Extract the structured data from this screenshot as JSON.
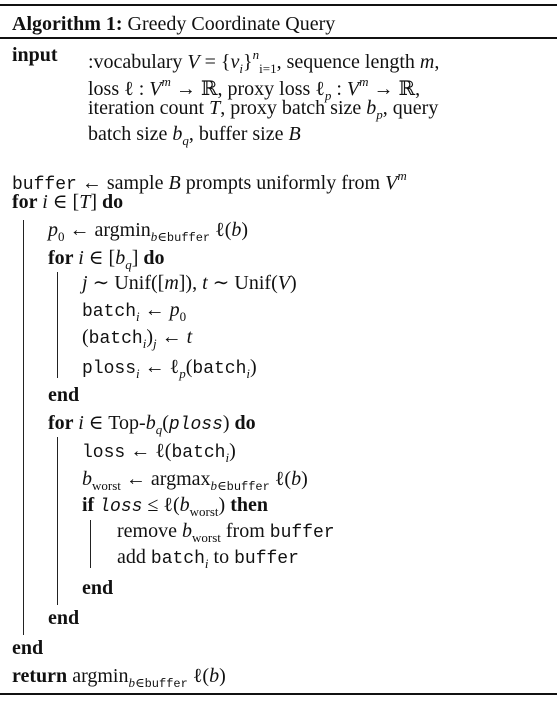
{
  "title": {
    "label": "Algorithm 1:",
    "name": "Greedy Coordinate Query"
  },
  "lines": [
    [
      [
        "b",
        "input"
      ]
    ],
    [
      [
        "r",
        ":vocabulary "
      ],
      [
        "i",
        "V"
      ],
      [
        "r",
        " = {"
      ],
      [
        "i",
        "v"
      ],
      [
        "i sub",
        "i"
      ],
      [
        "r",
        "}"
      ],
      [
        "i sup",
        "n"
      ],
      [
        "r sub",
        "i=1"
      ],
      [
        "r",
        ", sequence length "
      ],
      [
        "i",
        "m"
      ],
      [
        "r",
        ","
      ]
    ],
    [
      [
        "r",
        "loss ℓ : "
      ],
      [
        "i",
        "V"
      ],
      [
        "i sup",
        "m"
      ],
      [
        "r",
        " → ℝ, proxy loss ℓ"
      ],
      [
        "i sub",
        "p"
      ],
      [
        "r",
        " : "
      ],
      [
        "i",
        "V"
      ],
      [
        "i sup",
        "m"
      ],
      [
        "r",
        " → ℝ,"
      ]
    ],
    [
      [
        "r",
        "iteration count "
      ],
      [
        "i",
        "T"
      ],
      [
        "r",
        ", proxy batch size "
      ],
      [
        "i",
        "b"
      ],
      [
        "i sub",
        "p"
      ],
      [
        "r",
        ", query"
      ]
    ],
    [
      [
        "r",
        "batch size "
      ],
      [
        "i",
        "b"
      ],
      [
        "i sub",
        "q"
      ],
      [
        "r",
        ", buffer size "
      ],
      [
        "i",
        "B"
      ]
    ],
    [
      [
        "m",
        "buffer"
      ],
      [
        "r",
        " ← sample "
      ],
      [
        "i",
        "B"
      ],
      [
        "r",
        " prompts uniformly from "
      ],
      [
        "i",
        "V"
      ],
      [
        "i sup",
        "m"
      ]
    ],
    [
      [
        "b",
        "for "
      ],
      [
        "i",
        "i"
      ],
      [
        "r",
        " ∈ ["
      ],
      [
        "i",
        "T"
      ],
      [
        "r",
        "] "
      ],
      [
        "b",
        "do"
      ]
    ],
    [
      [
        "i",
        "p"
      ],
      [
        "r sub",
        "0"
      ],
      [
        "r",
        " ← argmin"
      ],
      [
        "i sub",
        "b"
      ],
      [
        "r sub",
        "∈"
      ],
      [
        "m sub",
        "buffer"
      ],
      [
        "r",
        " ℓ("
      ],
      [
        "i",
        "b"
      ],
      [
        "r",
        ")"
      ]
    ],
    [
      [
        "b",
        "for "
      ],
      [
        "i",
        "i"
      ],
      [
        "r",
        " ∈ ["
      ],
      [
        "i",
        "b"
      ],
      [
        "i sub",
        "q"
      ],
      [
        "r",
        "] "
      ],
      [
        "b",
        "do"
      ]
    ],
    [
      [
        "i",
        "j"
      ],
      [
        "r",
        " ∼ Unif(["
      ],
      [
        "i",
        "m"
      ],
      [
        "r",
        "]), "
      ],
      [
        "i",
        "t"
      ],
      [
        "r",
        " ∼ Unif("
      ],
      [
        "i",
        "V"
      ],
      [
        "r",
        ")"
      ]
    ],
    [
      [
        "m",
        "batch"
      ],
      [
        "i sub",
        "i"
      ],
      [
        "r",
        " ← "
      ],
      [
        "i",
        "p"
      ],
      [
        "r sub",
        "0"
      ]
    ],
    [
      [
        "r",
        "("
      ],
      [
        "m",
        "batch"
      ],
      [
        "i sub",
        "i"
      ],
      [
        "r",
        ")"
      ],
      [
        "i sub",
        "j"
      ],
      [
        "r",
        " ← "
      ],
      [
        "i",
        "t"
      ]
    ],
    [
      [
        "m",
        "ploss"
      ],
      [
        "i sub",
        "i"
      ],
      [
        "r",
        " ← ℓ"
      ],
      [
        "i sub",
        "p"
      ],
      [
        "r",
        "("
      ],
      [
        "m",
        "batch"
      ],
      [
        "i sub",
        "i"
      ],
      [
        "r",
        ")"
      ]
    ],
    [
      [
        "b",
        "end"
      ]
    ],
    [
      [
        "b",
        "for "
      ],
      [
        "i",
        "i"
      ],
      [
        "r",
        " ∈ Top-"
      ],
      [
        "i",
        "b"
      ],
      [
        "i sub",
        "q"
      ],
      [
        "r",
        "("
      ],
      [
        "m i",
        "ploss"
      ],
      [
        "r",
        ") "
      ],
      [
        "b",
        "do"
      ]
    ],
    [
      [
        "m",
        "loss"
      ],
      [
        "r",
        " ← ℓ("
      ],
      [
        "m",
        "batch"
      ],
      [
        "i sub",
        "i"
      ],
      [
        "r",
        ")"
      ]
    ],
    [
      [
        "i",
        "b"
      ],
      [
        "r sub",
        "worst"
      ],
      [
        "r",
        " ← argmax"
      ],
      [
        "i sub",
        "b"
      ],
      [
        "r sub",
        "∈"
      ],
      [
        "m sub",
        "buffer"
      ],
      [
        "r",
        " ℓ("
      ],
      [
        "i",
        "b"
      ],
      [
        "r",
        ")"
      ]
    ],
    [
      [
        "b",
        "if "
      ],
      [
        "m i",
        "loss"
      ],
      [
        "r",
        " ≤ ℓ("
      ],
      [
        "i",
        "b"
      ],
      [
        "r sub",
        "worst"
      ],
      [
        "r",
        ") "
      ],
      [
        "b",
        "then"
      ]
    ],
    [
      [
        "r",
        "remove "
      ],
      [
        "i",
        "b"
      ],
      [
        "r sub",
        "worst"
      ],
      [
        "r",
        " from "
      ],
      [
        "m",
        "buffer"
      ]
    ],
    [
      [
        "r",
        "add "
      ],
      [
        "m",
        "batch"
      ],
      [
        "i sub",
        "i"
      ],
      [
        "r",
        " to "
      ],
      [
        "m",
        "buffer"
      ]
    ],
    [
      [
        "b",
        "end"
      ]
    ],
    [
      [
        "b",
        "end"
      ]
    ],
    [
      [
        "b",
        "end"
      ]
    ],
    [
      [
        "b",
        "return "
      ],
      [
        "r",
        "argmin"
      ],
      [
        "i sub",
        "b"
      ],
      [
        "r sub",
        "∈"
      ],
      [
        "m sub",
        "buffer"
      ],
      [
        "r",
        " ℓ("
      ],
      [
        "i",
        "b"
      ],
      [
        "r",
        ")"
      ]
    ]
  ]
}
